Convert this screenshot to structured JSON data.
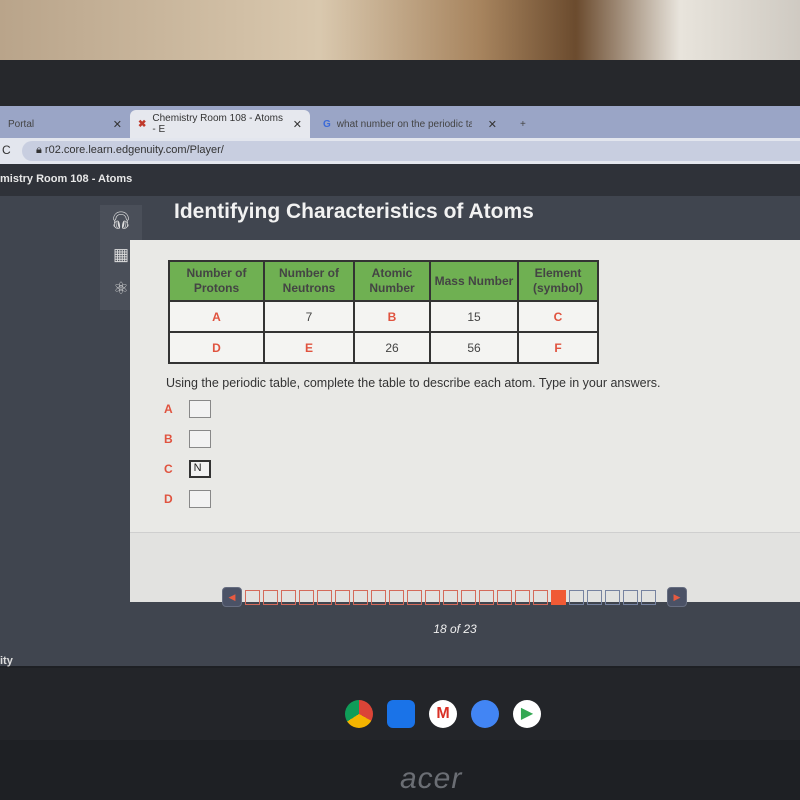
{
  "browser": {
    "tabs": [
      {
        "label": "Portal",
        "active": false
      },
      {
        "label": "Chemistry Room 108 - Atoms - E",
        "active": true,
        "icon": "edgenuity-x-icon"
      },
      {
        "label": "what number on the periodic tab",
        "active": false,
        "icon": "google-icon"
      }
    ],
    "url": "r02.core.learn.edgenuity.com/Player/"
  },
  "app": {
    "course_title": "mistry Room 108 - Atoms",
    "footer": "ity"
  },
  "lesson": {
    "title": "Identifying Characteristics of Atoms",
    "tools": [
      "headphones-icon",
      "calculator-icon",
      "atom-icon"
    ],
    "table": {
      "headers": [
        "Number of Protons",
        "Number of Neutrons",
        "Atomic Number",
        "Mass Number",
        "Element (symbol)"
      ],
      "rows": [
        [
          "A",
          "7",
          "B",
          "15",
          "C"
        ],
        [
          "D",
          "E",
          "26",
          "56",
          "F"
        ]
      ]
    },
    "instruction": "Using the periodic table, complete the table to describe each atom. Type in your answers.",
    "answers": [
      {
        "label": "A",
        "value": ""
      },
      {
        "label": "B",
        "value": ""
      },
      {
        "label": "C",
        "value": "N"
      },
      {
        "label": "D",
        "value": ""
      }
    ]
  },
  "progress": {
    "current": 18,
    "total": 23,
    "counter": "18 of 23"
  },
  "colors": {
    "accent": "#f05a35",
    "header_green": "#6fb052",
    "question_red": "#e0533f"
  },
  "device": {
    "brand": "acer"
  }
}
